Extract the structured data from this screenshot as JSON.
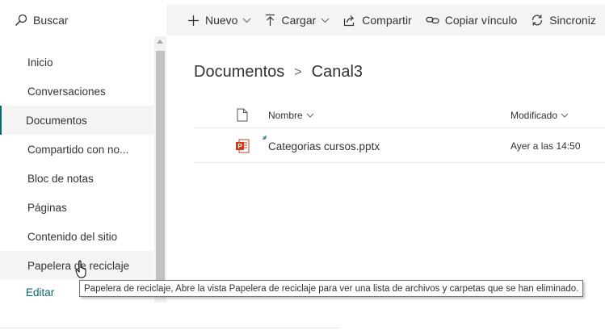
{
  "search": {
    "label": "Buscar"
  },
  "commands": [
    {
      "label": "Nuevo",
      "icon": "plus-icon",
      "dropdown": true
    },
    {
      "label": "Cargar",
      "icon": "upload-icon",
      "dropdown": true
    },
    {
      "label": "Compartir",
      "icon": "share-icon",
      "dropdown": false
    },
    {
      "label": "Copiar vínculo",
      "icon": "link-icon",
      "dropdown": false
    },
    {
      "label": "Sincroniz",
      "icon": "sync-icon",
      "dropdown": false
    }
  ],
  "nav": {
    "items": [
      {
        "label": "Inicio"
      },
      {
        "label": "Conversaciones"
      },
      {
        "label": "Documentos"
      },
      {
        "label": "Compartido con no..."
      },
      {
        "label": "Bloc de notas"
      },
      {
        "label": "Páginas"
      },
      {
        "label": "Contenido del sitio"
      },
      {
        "label": "Papelera de reciclaje"
      }
    ],
    "selected_index": 2,
    "hover_index": 7,
    "edit_label": "Editar"
  },
  "breadcrumb": {
    "parent": "Documentos",
    "separator": ">",
    "current": "Canal3"
  },
  "list": {
    "columns": {
      "name": "Nombre",
      "modified": "Modificado"
    },
    "rows": [
      {
        "name": "Categorias cursos.pptx",
        "modified": "Ayer a las 14:50",
        "type": "pptx"
      }
    ]
  },
  "tooltip": {
    "text": "Papelera de reciclaje, Abre la vista Papelera de reciclaje para ver una lista de archivos y carpetas que se han eliminado."
  },
  "colors": {
    "accent": "#036c70",
    "command_bar_bg": "#f4f4f4",
    "powerpoint": "#c43e1c"
  }
}
